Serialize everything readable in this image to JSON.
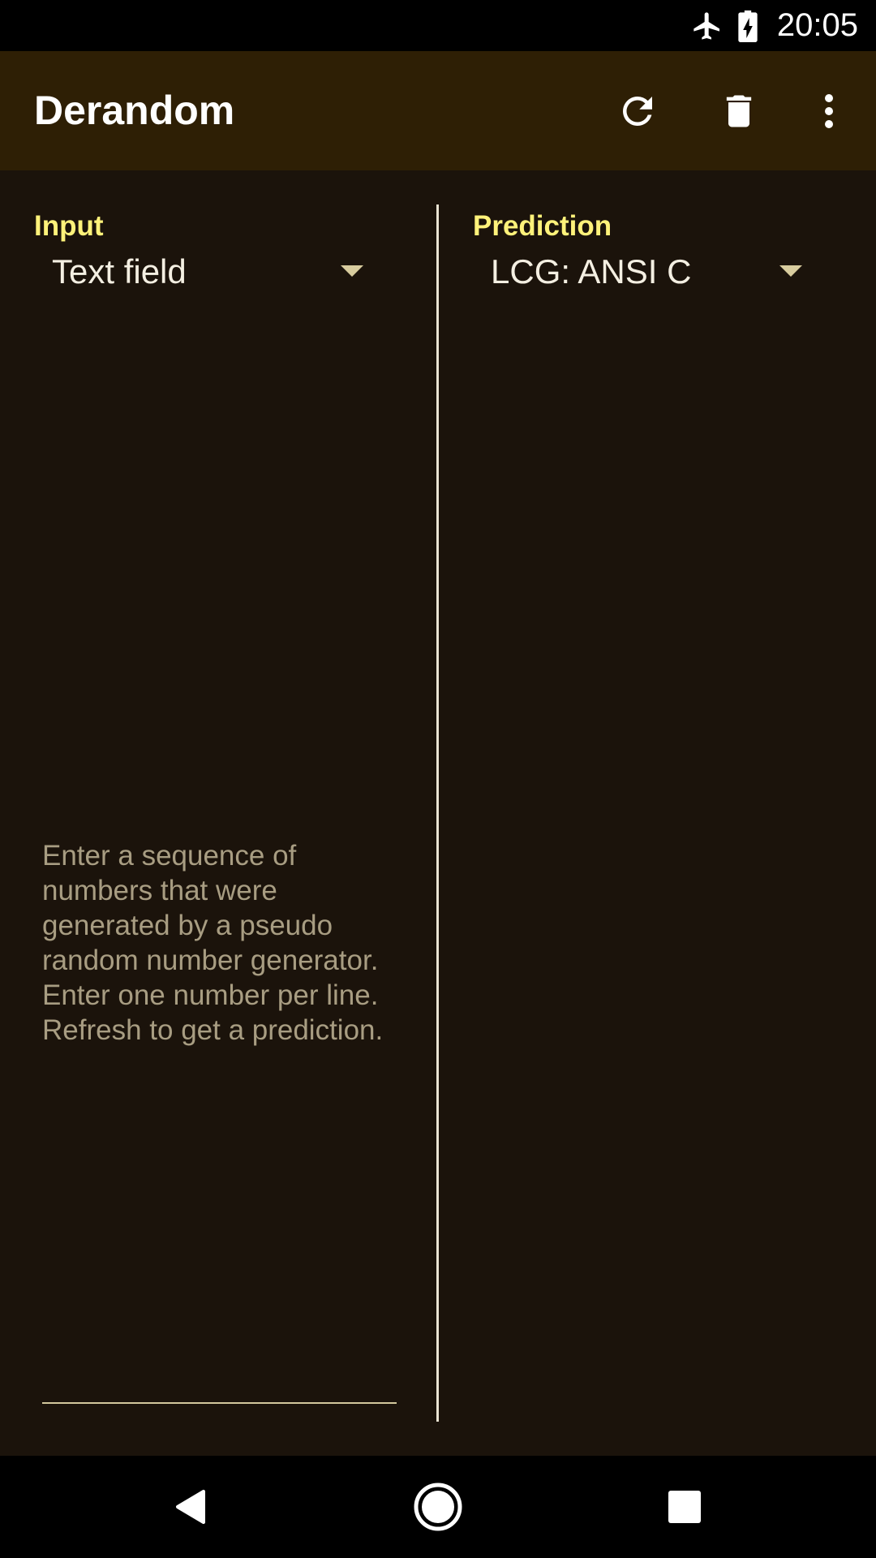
{
  "status_bar": {
    "time": "20:05",
    "icons": [
      "airplane-mode-icon",
      "battery-charging-icon"
    ]
  },
  "app_bar": {
    "title": "Derandom",
    "actions": [
      "refresh-icon",
      "delete-icon",
      "overflow-menu-icon"
    ]
  },
  "input": {
    "label": "Input",
    "selected": "Text field",
    "placeholder": "Enter a sequence of numbers that were generated by a pseudo random number generator. Enter one number per line. Refresh to get a prediction."
  },
  "prediction": {
    "label": "Prediction",
    "selected": "LCG: ANSI C"
  },
  "nav_bar": {
    "buttons": [
      "back-icon",
      "home-icon",
      "recents-icon"
    ]
  },
  "colors": {
    "background": "#1b130b",
    "app_bar": "#2e1f05",
    "accent": "#fff27a"
  }
}
